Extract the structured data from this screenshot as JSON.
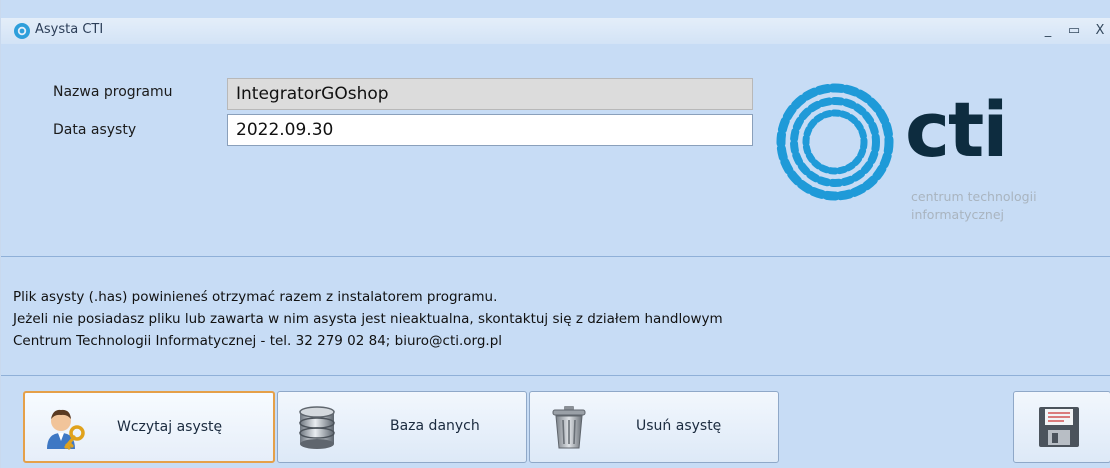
{
  "window": {
    "title": "Asysta CTI",
    "minimize_glyph": "_",
    "maximize_glyph": "▭",
    "close_glyph": "X"
  },
  "form": {
    "program_label": "Nazwa programu",
    "program_value": "IntegratorGOshop",
    "date_label": "Data asysty",
    "date_value": "2022.09.30"
  },
  "logo": {
    "wordmark": "cti",
    "subtitle_line1": "centrum technologii",
    "subtitle_line2": "informatycznej",
    "color_main": "#0d2c3f",
    "color_ring": "#1f9ad8",
    "color_sub": "#a9b4bf"
  },
  "info": {
    "line1": "Plik asysty (.has) powinieneś otrzymać razem z instalatorem programu.",
    "line2": "Jeżeli nie posiadasz pliku lub zawarta w nim asysta jest nieaktualna, skontaktuj się z działem handlowym",
    "line3": "Centrum Technologii Informatycznej - tel. 32 279 02 84; biuro@cti.org.pl"
  },
  "toolbar": {
    "load_label": "Wczytaj asystę",
    "load_icon": "user-key-icon",
    "db_label": "Baza danych",
    "db_icon": "database-icon",
    "delete_label": "Usuń asystę",
    "delete_icon": "trash-icon",
    "save_icon": "floppy-disk-icon"
  },
  "colors": {
    "panel_bg": "#c7dcf5",
    "active_border": "#e5a049"
  }
}
